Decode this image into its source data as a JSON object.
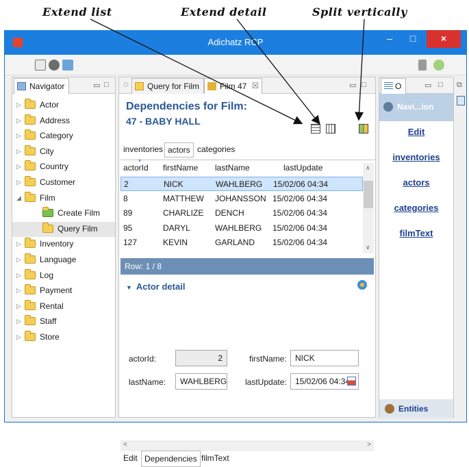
{
  "annotations": {
    "extend_list": "Extend list",
    "extend_detail": "Extend detail",
    "split_vertically": "Split vertically"
  },
  "window": {
    "title": "Adichatz RCP",
    "min_glyph": "–",
    "max_glyph": "□",
    "close_glyph": "×"
  },
  "navigator": {
    "tab_label": "Navigator",
    "items": [
      {
        "label": "Actor",
        "level": 0
      },
      {
        "label": "Address",
        "level": 0
      },
      {
        "label": "Category",
        "level": 0
      },
      {
        "label": "City",
        "level": 0
      },
      {
        "label": "Country",
        "level": 0
      },
      {
        "label": "Customer",
        "level": 0
      },
      {
        "label": "Film",
        "level": 0
      },
      {
        "label": "Create Film",
        "level": 1
      },
      {
        "label": "Query Film",
        "level": 1
      },
      {
        "label": "Inventory",
        "level": 0
      },
      {
        "label": "Language",
        "level": 0
      },
      {
        "label": "Log",
        "level": 0
      },
      {
        "label": "Payment",
        "level": 0
      },
      {
        "label": "Rental",
        "level": 0
      },
      {
        "label": "Staff",
        "level": 0
      },
      {
        "label": "Store",
        "level": 0
      }
    ]
  },
  "editor": {
    "tabs": [
      "Query for Film",
      "Film 47"
    ],
    "close_glyph": "☒",
    "heading_line1": "Dependencies for Film:",
    "heading_line2": "47 - BABY HALL",
    "subtabs": [
      "inventories",
      "actors",
      "categories"
    ],
    "columns": [
      "actorId",
      "firstName",
      "lastName",
      "lastUpdate"
    ],
    "rows": [
      [
        "2",
        "NICK",
        "WAHLBERG",
        "15/02/06 04:34"
      ],
      [
        "8",
        "MATTHEW",
        "JOHANSSON",
        "15/02/06 04:34"
      ],
      [
        "89",
        "CHARLIZE",
        "DENCH",
        "15/02/06 04:34"
      ],
      [
        "95",
        "DARYL",
        "WAHLBERG",
        "15/02/06 04:34"
      ],
      [
        "127",
        "KEVIN",
        "GARLAND",
        "15/02/06 04:34"
      ]
    ],
    "row_status": "Row: 1 / 8",
    "detail_title": "Actor detail",
    "fields": {
      "actorId_label": "actorId:",
      "actorId_value": "2",
      "firstName_label": "firstName:",
      "firstName_value": "NICK",
      "lastName_label": "lastName:",
      "lastName_value": "WAHLBERG",
      "lastUpdate_label": "lastUpdate:",
      "lastUpdate_value": "15/02/06 04:34"
    },
    "bottom_tabs": [
      "Edit",
      "Dependencies",
      "filmText"
    ]
  },
  "outline": {
    "tab_label": "O",
    "nav_label": "Navi...ion",
    "links": [
      "Edit",
      "inventories",
      "actors",
      "categories",
      "filmText"
    ],
    "entities_label": "Entities"
  },
  "colors": {
    "title_bar": "#1c7fe0",
    "heading_blue": "#2a5893",
    "row_bar": "#6d8fb5",
    "selection": "#cfe5fb"
  }
}
